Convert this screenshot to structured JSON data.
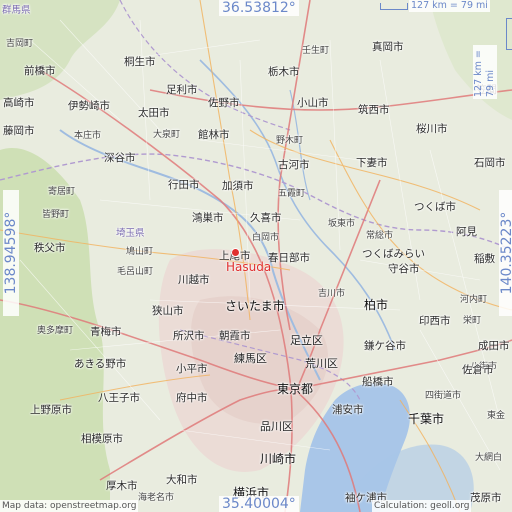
{
  "map": {
    "place": "Hasuda",
    "lat_top": "36.53812°",
    "lat_bottom": "35.40004°",
    "lon_left": "138.94598°",
    "lon_right": "140.35223°",
    "scale_h": "127 km = 79 mi",
    "scale_v": "127 km = 79 mi",
    "attribution": "Map data: openstreetmap.org",
    "calculation": "Calculation: geoll.org"
  },
  "labels": [
    {
      "id": "l1",
      "text": "吉岡町"
    },
    {
      "id": "l2",
      "text": "壬生町"
    },
    {
      "id": "l3",
      "text": "真岡市"
    },
    {
      "id": "l4",
      "text": "桐生市"
    },
    {
      "id": "l5",
      "text": "栃木市"
    },
    {
      "id": "l6",
      "text": "前橋市"
    },
    {
      "id": "l7",
      "text": "足利市"
    },
    {
      "id": "l8",
      "text": "佐野市"
    },
    {
      "id": "l9",
      "text": "小山市"
    },
    {
      "id": "l10",
      "text": "筑西市"
    },
    {
      "id": "l11",
      "text": "高崎市"
    },
    {
      "id": "l12",
      "text": "伊勢崎市"
    },
    {
      "id": "l13",
      "text": "太田市"
    },
    {
      "id": "l14",
      "text": "笠間"
    },
    {
      "id": "l15",
      "text": "藤岡市"
    },
    {
      "id": "l16",
      "text": "本庄市"
    },
    {
      "id": "l17",
      "text": "大泉町"
    },
    {
      "id": "l18",
      "text": "館林市"
    },
    {
      "id": "l19",
      "text": "野木町"
    },
    {
      "id": "l20",
      "text": "桜川市"
    },
    {
      "id": "l21",
      "text": "深谷市"
    },
    {
      "id": "l22",
      "text": "古河市"
    },
    {
      "id": "l23",
      "text": "下妻市"
    },
    {
      "id": "l24",
      "text": "石岡市"
    },
    {
      "id": "l25",
      "text": "寄居町"
    },
    {
      "id": "l26",
      "text": "行田市"
    },
    {
      "id": "l27",
      "text": "加須市"
    },
    {
      "id": "l28",
      "text": "五霞町"
    },
    {
      "id": "l29",
      "text": "皆野町"
    },
    {
      "id": "l30",
      "text": "鴻巣市"
    },
    {
      "id": "l31",
      "text": "久喜市"
    },
    {
      "id": "l32",
      "text": "坂東市"
    },
    {
      "id": "l33",
      "text": "常総市"
    },
    {
      "id": "l34",
      "text": "つくば市"
    },
    {
      "id": "l35",
      "text": "埼玉県"
    },
    {
      "id": "l36",
      "text": "鳩山町"
    },
    {
      "id": "l37",
      "text": "白岡市"
    },
    {
      "id": "l38",
      "text": "秩父市"
    },
    {
      "id": "l39",
      "text": "上尾市"
    },
    {
      "id": "l40",
      "text": "春日部市"
    },
    {
      "id": "l41",
      "text": "つくばみらい"
    },
    {
      "id": "l42",
      "text": "阿見"
    },
    {
      "id": "l43",
      "text": "毛呂山町"
    },
    {
      "id": "l44",
      "text": "稲敷"
    },
    {
      "id": "l45",
      "text": "川越市"
    },
    {
      "id": "l46",
      "text": "守谷市"
    },
    {
      "id": "l47",
      "text": "吉川市"
    },
    {
      "id": "l48",
      "text": "河内町"
    },
    {
      "id": "l49",
      "text": "狭山市"
    },
    {
      "id": "l50",
      "text": "さいたま市"
    },
    {
      "id": "l51",
      "text": "柏市"
    },
    {
      "id": "l52",
      "text": "奥多摩町"
    },
    {
      "id": "l53",
      "text": "青梅市"
    },
    {
      "id": "l54",
      "text": "所沢市"
    },
    {
      "id": "l55",
      "text": "朝霞市"
    },
    {
      "id": "l56",
      "text": "足立区"
    },
    {
      "id": "l57",
      "text": "印西市"
    },
    {
      "id": "l58",
      "text": "栄町"
    },
    {
      "id": "l59",
      "text": "練馬区"
    },
    {
      "id": "l60",
      "text": "荒川区"
    },
    {
      "id": "l61",
      "text": "鎌ケ谷市"
    },
    {
      "id": "l62",
      "text": "成田市"
    },
    {
      "id": "l63",
      "text": "あきる野市"
    },
    {
      "id": "l64",
      "text": "小平市"
    },
    {
      "id": "l65",
      "text": "八街市"
    },
    {
      "id": "l66",
      "text": "東京都"
    },
    {
      "id": "l67",
      "text": "船橋市"
    },
    {
      "id": "l68",
      "text": "佐倉市"
    },
    {
      "id": "l69",
      "text": "八王子市"
    },
    {
      "id": "l70",
      "text": "府中市"
    },
    {
      "id": "l71",
      "text": "四街道市"
    },
    {
      "id": "l72",
      "text": "上野原市"
    },
    {
      "id": "l73",
      "text": "浦安市"
    },
    {
      "id": "l74",
      "text": "千葉市"
    },
    {
      "id": "l75",
      "text": "相模原市"
    },
    {
      "id": "l76",
      "text": "品川区"
    },
    {
      "id": "l77",
      "text": "大網白"
    },
    {
      "id": "l78",
      "text": "川崎市"
    },
    {
      "id": "l79",
      "text": "厚木市"
    },
    {
      "id": "l80",
      "text": "大和市"
    },
    {
      "id": "l81",
      "text": "海老名市"
    },
    {
      "id": "l82",
      "text": "横浜市"
    },
    {
      "id": "l83",
      "text": "袖ケ浦市"
    },
    {
      "id": "l84",
      "text": "茂原市"
    },
    {
      "id": "l85",
      "text": "群馬県"
    },
    {
      "id": "l86",
      "text": "東金"
    }
  ]
}
